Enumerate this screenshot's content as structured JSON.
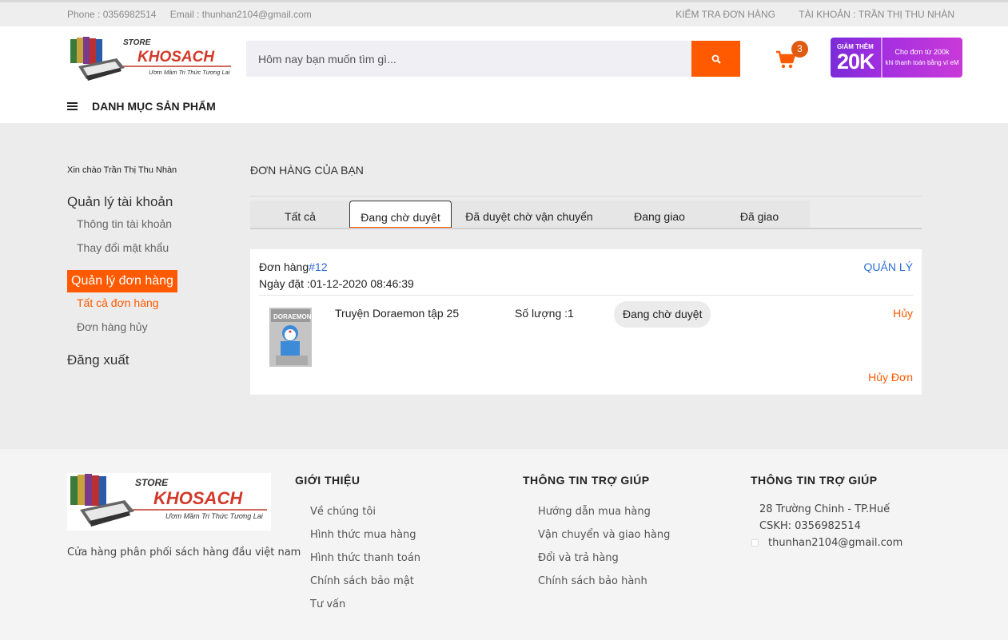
{
  "topbar": {
    "phone": "Phone : 0356982514",
    "email": "Email : thunhan2104@gmail.com",
    "check_order": "KIỂM TRA ĐƠN HÀNG",
    "account": "TÀI KHOẢN : TRẦN THỊ THU NHÀN"
  },
  "logo": {
    "store": "STORE",
    "name": "KHOSACH",
    "slogan": "Ươm Mầm Tri Thức Tương Lai"
  },
  "search": {
    "placeholder": "Hôm nay bạn muốn tìm gì...",
    "icon": "search-icon"
  },
  "cart": {
    "count": "3",
    "icon": "cart-icon"
  },
  "promo": {
    "top": "GIẢM THÊM",
    "amount": "20K",
    "line1": "Cho đơn từ 200k",
    "line2": "khi thanh toán bằng ví eM"
  },
  "category": {
    "label": "DANH MỤC SẢN PHẨM",
    "icon": "menu-icon"
  },
  "sidebar": {
    "greeting": "Xin chào Trần Thị Thu Nhàn",
    "account_manage": "Quản lý tài khoản",
    "account_info": "Thông tin tài khoản",
    "change_password": "Thay đổi mật khẩu",
    "order_manage": "Quản lý đơn hàng",
    "all_orders": "Tất cả đơn hàng",
    "cancelled_orders": "Đơn hàng hủy",
    "logout": "Đăng xuất"
  },
  "main": {
    "title": "ĐƠN HÀNG CỦA BẠN",
    "tabs": [
      {
        "label": "Tất cả"
      },
      {
        "label": "Đang chờ duyệt"
      },
      {
        "label": "Đã duyệt chờ vận chuyển"
      },
      {
        "label": "Đang giao"
      },
      {
        "label": "Đã giao"
      }
    ],
    "active_tab": "Đang chờ duyệt"
  },
  "order": {
    "label": "Đơn hàng",
    "id": "#12",
    "date": "Ngày đặt :01-12-2020 08:46:39",
    "manage": "QUẢN LÝ",
    "item": {
      "name": "Truyện Doraemon tập 25",
      "cover_title": "DORAEMON",
      "quantity": "Số lượng :1",
      "status": "Đang chờ duyệt",
      "cancel": "Hủy"
    },
    "cancel_order": "Hủy Đơn"
  },
  "footer": {
    "description": "Cửa hàng phân phối sách hàng đầu việt nam",
    "about": {
      "title": "GIỚI THIỆU",
      "links": [
        "Về chúng tôi",
        "Hình thức mua hàng",
        "Hình thức thanh toán",
        "Chính sách bảo mật",
        "Tư vấn"
      ]
    },
    "help": {
      "title": "THÔNG TIN TRỢ GIÚP",
      "links": [
        "Hướng dẫn mua hàng",
        "Vận chuyển và giao hàng",
        "Đổi và trả hàng",
        "Chính sách bảo hành"
      ]
    },
    "contact": {
      "title": "THÔNG TIN TRỢ GIÚP",
      "address": "28 Trường Chinh - TP.Huế",
      "phone": "CSKH: 0356982514",
      "email": "thunhan2104@gmail.com"
    }
  },
  "colors": {
    "accent": "#ff5a00",
    "link": "#2b6cd6"
  }
}
